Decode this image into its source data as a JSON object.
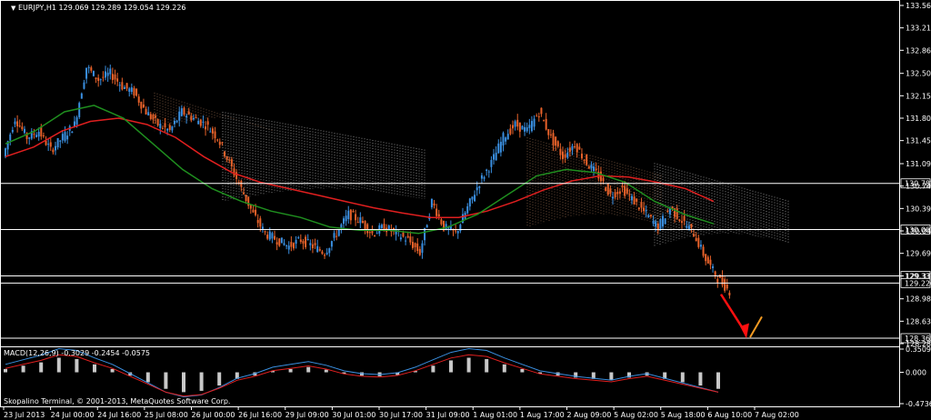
{
  "chart_data": [
    {
      "type": "candlestick",
      "title": "EURJPY,H1  129.069 129.289 129.054 129.226",
      "symbol_icon": "triangle-down-icon",
      "ylim": [
        128.28,
        133.56
      ],
      "y_ticks": [
        "133.560",
        "133.210",
        "132.860",
        "132.500",
        "132.150",
        "131.800",
        "131.450",
        "131.090",
        "130.740",
        "130.390",
        "130.040",
        "129.690",
        "129.337",
        "128.980",
        "128.630",
        "128.280"
      ],
      "level_labels": [
        {
          "value": 130.782,
          "label": "130.782",
          "boxed": true
        },
        {
          "value": 130.062,
          "label": "130.062",
          "boxed": true
        },
        {
          "value": 129.337,
          "label": "129.337",
          "boxed": true
        },
        {
          "value": 129.226,
          "label": "129.226",
          "boxed": true
        },
        {
          "value": 128.365,
          "label": "128.365",
          "boxed": true
        }
      ],
      "x_ticks": [
        "23 Jul 2013",
        "24 Jul 00:00",
        "24 Jul 16:00",
        "25 Jul 08:00",
        "26 Jul 00:00",
        "26 Jul 16:00",
        "29 Jul 09:00",
        "30 Jul 01:00",
        "30 Jul 17:00",
        "31 Jul 09:00",
        "1 Aug 01:00",
        "1 Aug 17:00",
        "2 Aug 09:00",
        "5 Aug 02:00",
        "5 Aug 18:00",
        "6 Aug 10:00",
        "7 Aug 02:00"
      ],
      "series": [
        {
          "kind": "price",
          "color_up": "#3a8fe0",
          "color_down": "#e8622a",
          "values": [
            131.2,
            131.8,
            131.5,
            131.6,
            131.3,
            131.5,
            131.7,
            132.6,
            132.4,
            132.5,
            132.3,
            132.2,
            131.9,
            131.7,
            131.6,
            131.9,
            131.8,
            131.7,
            131.5,
            131.1,
            130.7,
            130.3,
            130.0,
            129.9,
            129.8,
            129.9,
            129.8,
            129.7,
            130.0,
            130.3,
            130.2,
            130.0,
            130.1,
            130.0,
            129.9,
            129.7,
            130.5,
            130.1,
            130.0,
            130.4,
            130.8,
            131.1,
            131.5,
            131.7,
            131.6,
            131.9,
            131.5,
            131.2,
            131.4,
            131.1,
            130.9,
            130.6,
            130.7,
            130.5,
            130.3,
            130.1,
            130.4,
            130.2,
            130.0,
            129.6,
            129.3,
            129.1
          ]
        },
        {
          "kind": "ma",
          "color": "#e01f1f",
          "values": [
            131.2,
            131.35,
            131.6,
            131.75,
            131.8,
            131.7,
            131.5,
            131.2,
            130.95,
            130.8,
            130.7,
            130.6,
            130.5,
            130.4,
            130.32,
            130.25,
            130.25,
            130.35,
            130.5,
            130.68,
            130.82,
            130.9,
            130.88,
            130.8,
            130.7,
            130.5
          ]
        },
        {
          "kind": "ma",
          "color": "#1f8f1f",
          "values": [
            131.4,
            131.6,
            131.9,
            132.0,
            131.8,
            131.4,
            131.0,
            130.7,
            130.5,
            130.35,
            130.25,
            130.1,
            130.05,
            130.05,
            130.0,
            130.1,
            130.3,
            130.6,
            130.9,
            131.0,
            130.95,
            130.8,
            130.5,
            130.3,
            130.15
          ]
        }
      ],
      "annotations": [
        {
          "type": "arrow",
          "color": "#ff1010",
          "from": [
            "7 Aug 02:00",
            129.1
          ],
          "to": [
            "7 Aug 02:00+",
            128.4
          ]
        },
        {
          "type": "line",
          "color": "#f29a22",
          "from": [
            "end",
            128.4
          ],
          "to": [
            "end+",
            128.7
          ]
        }
      ]
    },
    {
      "type": "histogram",
      "title": "MACD(12,26,9) -0.3029 -0.2454 -0.0575",
      "ylim": [
        -0.4736,
        0.3509
      ],
      "y_ticks": [
        "0.3509",
        "0.000",
        "-0.4736"
      ],
      "series": [
        {
          "kind": "histogram",
          "color": "#c8c8c8",
          "values": [
            0.05,
            0.1,
            0.15,
            0.22,
            0.2,
            0.12,
            0.05,
            -0.05,
            -0.15,
            -0.25,
            -0.3,
            -0.28,
            -0.2,
            -0.1,
            -0.05,
            0.02,
            0.05,
            0.08,
            0.04,
            -0.02,
            -0.05,
            -0.06,
            -0.04,
            0.02,
            0.1,
            0.18,
            0.22,
            0.2,
            0.12,
            0.05,
            -0.02,
            -0.05,
            -0.08,
            -0.1,
            -0.12,
            -0.08,
            -0.05,
            -0.1,
            -0.15,
            -0.2,
            -0.25
          ]
        }
      ]
    }
  ],
  "footer": {
    "copyright": "Skopalino Terminal, © 2001-2013, MetaQuotes Software Corp."
  },
  "colors": {
    "background": "#000000",
    "axis": "#ffffff",
    "grid": "#3a3a3a",
    "cloud_bull": "#b5805f",
    "cloud_bear": "#dcdcdc"
  }
}
